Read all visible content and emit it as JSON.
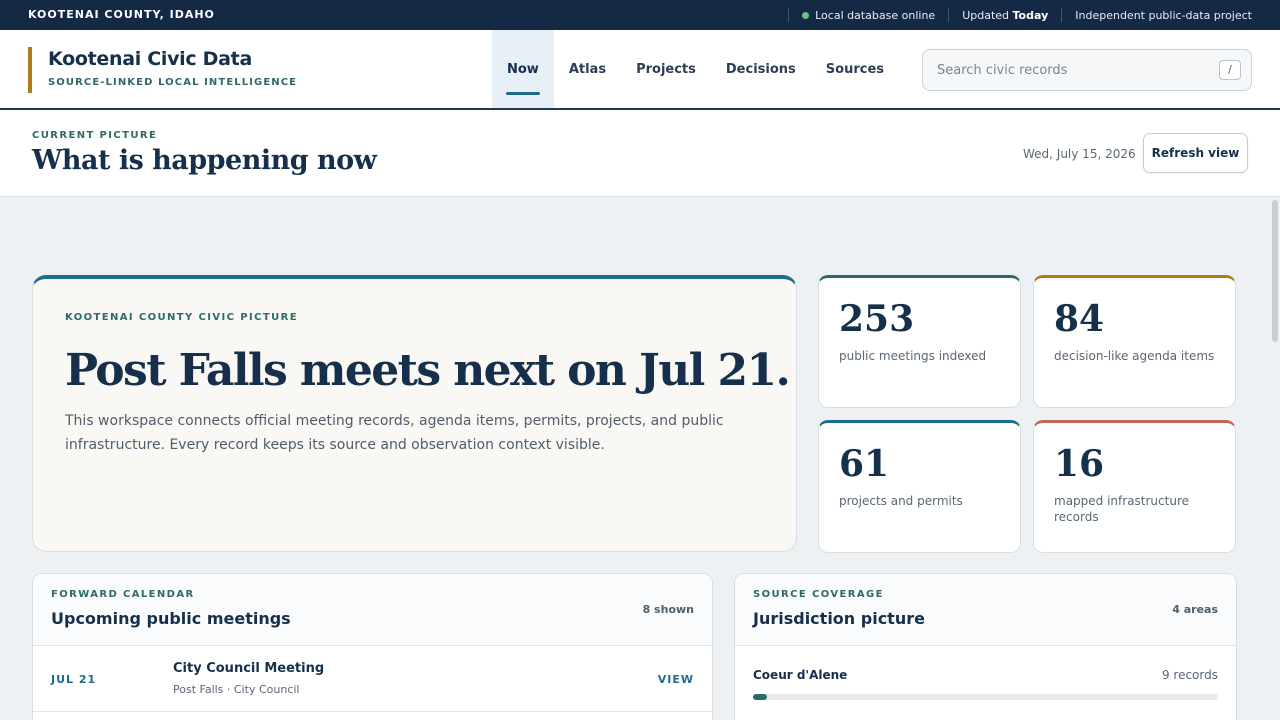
{
  "topbar": {
    "county": "KOOTENAI COUNTY, IDAHO",
    "status": "Local database online",
    "updated_label": "Updated",
    "updated_value": "Today",
    "project_note": "Independent public-data project"
  },
  "brand": {
    "name": "Kootenai Civic Data",
    "tagline": "SOURCE-LINKED LOCAL INTELLIGENCE"
  },
  "nav": [
    {
      "label": "Now",
      "active": true
    },
    {
      "label": "Atlas",
      "active": false
    },
    {
      "label": "Projects",
      "active": false
    },
    {
      "label": "Decisions",
      "active": false
    },
    {
      "label": "Sources",
      "active": false
    }
  ],
  "search": {
    "placeholder": "Search civic records",
    "shortcut": "/"
  },
  "page": {
    "eyebrow": "CURRENT PICTURE",
    "title": "What is happening now",
    "date": "Wed, July 15, 2026",
    "refresh_label": "Refresh view"
  },
  "hero": {
    "eyebrow": "KOOTENAI COUNTY CIVIC PICTURE",
    "headline": "Post Falls meets next on Jul 21.",
    "description": "This workspace connects official meeting records, agenda items, permits, projects, and public infrastructure. Every record keeps its source and observation context visible."
  },
  "stats": [
    {
      "value": "253",
      "label": "public meetings indexed",
      "accent": "#2f6a66"
    },
    {
      "value": "84",
      "label": "decision-like agenda items",
      "accent": "#b07c1a"
    },
    {
      "value": "61",
      "label": "projects and permits",
      "accent": "#1f6b8e"
    },
    {
      "value": "16",
      "label": "mapped infrastructure records",
      "accent": "#c0665a"
    }
  ],
  "calendar": {
    "eyebrow": "FORWARD CALENDAR",
    "title": "Upcoming public meetings",
    "count": "8 shown",
    "meetings": [
      {
        "date": "JUL 21",
        "title": "City Council Meeting",
        "subtitle": "Post Falls · City Council",
        "action": "VIEW"
      }
    ]
  },
  "coverage": {
    "eyebrow": "SOURCE COVERAGE",
    "title": "Jurisdiction picture",
    "count": "4 areas",
    "areas": [
      {
        "name": "Coeur d'Alene",
        "records": "9 records",
        "fill": 0.03
      }
    ]
  },
  "colors": {
    "navy": "#142a44",
    "teal": "#2f6a66",
    "blue": "#1f6b8e",
    "gold": "#b07c1a",
    "rust": "#c0665a",
    "status_green": "#6cc08f"
  }
}
